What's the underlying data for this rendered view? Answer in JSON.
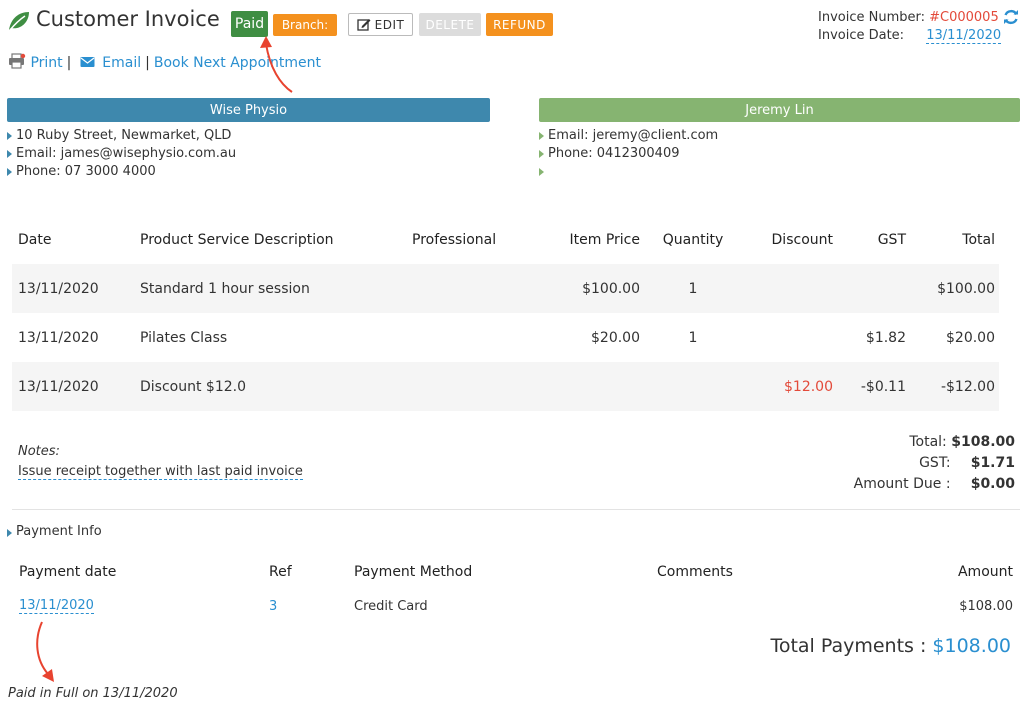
{
  "header": {
    "title": "Customer Invoice",
    "status_badge": "Paid",
    "branch_label": "Branch:",
    "edit_label": "EDIT",
    "delete_label": "DELETE",
    "refund_label": "REFUND"
  },
  "invoice_meta": {
    "number_label": "Invoice Number:",
    "number_value": "#C000005",
    "date_label": "Invoice Date:",
    "date_value": "13/11/2020"
  },
  "actions": {
    "print": "Print",
    "email": "Email",
    "book_next": "Book Next Appointment"
  },
  "business": {
    "name": "Wise Physio",
    "address": "10 Ruby Street, Newmarket, QLD",
    "email": "Email: james@wisephysio.com.au",
    "phone": "Phone: 07 3000 4000"
  },
  "client": {
    "name": "Jeremy Lin",
    "email": "Email: jeremy@client.com",
    "phone": "Phone: 0412300409",
    "extra": ""
  },
  "items_table": {
    "headers": {
      "date": "Date",
      "description": "Product Service Description",
      "professional": "Professional",
      "item_price": "Item Price",
      "quantity": "Quantity",
      "discount": "Discount",
      "gst": "GST",
      "total": "Total"
    },
    "rows": [
      {
        "date": "13/11/2020",
        "description": "Standard 1 hour session",
        "professional": "",
        "item_price": "$100.00",
        "quantity": "1",
        "discount": "",
        "gst": "",
        "total": "$100.00"
      },
      {
        "date": "13/11/2020",
        "description": "Pilates Class",
        "professional": "",
        "item_price": "$20.00",
        "quantity": "1",
        "discount": "",
        "gst": "$1.82",
        "total": "$20.00"
      },
      {
        "date": "13/11/2020",
        "description": "Discount $12.0",
        "professional": "",
        "item_price": "",
        "quantity": "",
        "discount": "$12.00",
        "gst": "-$0.11",
        "total": "-$12.00"
      }
    ]
  },
  "notes": {
    "label": "Notes:",
    "text": "Issue receipt together with last paid invoice"
  },
  "totals": {
    "total_label": "Total:",
    "total_value": "$108.00",
    "gst_label": "GST:",
    "gst_value": "$1.71",
    "amount_due_label": "Amount Due :",
    "amount_due_value": "$0.00"
  },
  "payment_info": {
    "section_label": "Payment Info",
    "headers": {
      "date": "Payment date",
      "ref": "Ref",
      "method": "Payment Method",
      "comments": "Comments",
      "amount": "Amount"
    },
    "rows": [
      {
        "date": "13/11/2020",
        "ref": "3",
        "method": "Credit Card",
        "comments": "",
        "amount": "$108.00"
      }
    ],
    "total_label": "Total Payments :",
    "total_value": "$108.00"
  },
  "footer": {
    "paid_in_full": "Paid in Full on 13/11/2020"
  },
  "colors": {
    "paid_green": "#3f8e43",
    "orange": "#f4911e",
    "business_bar": "#3e88ad",
    "client_bar": "#86b471",
    "link_blue": "#2a8fd0",
    "red": "#e34a3a"
  }
}
